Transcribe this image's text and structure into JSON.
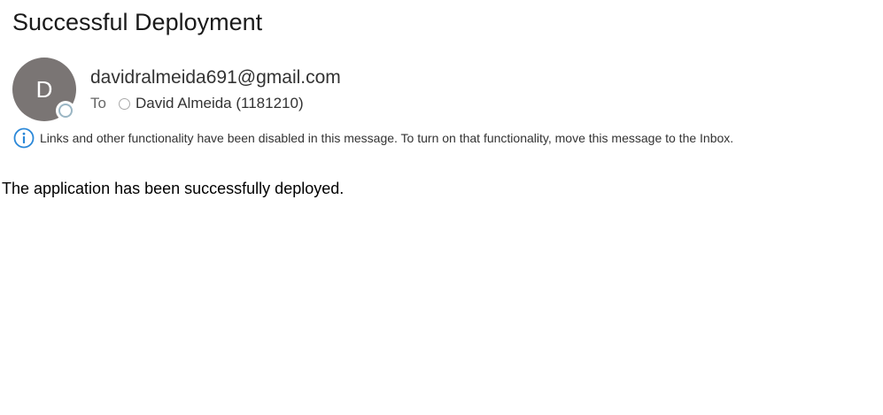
{
  "message": {
    "subject": "Successful Deployment",
    "avatar_initial": "D",
    "sender_email": "davidralmeida691@gmail.com",
    "to_label": "To",
    "recipient": "David Almeida (1181210)",
    "info_bar_text": "Links and other functionality have been disabled in this message. To turn on that functionality, move this message to the Inbox.",
    "body": "The application has been successfully deployed."
  },
  "icons": {
    "info": "info-icon",
    "presence": "presence-status-icon",
    "recipient_status": "recipient-status-icon"
  },
  "colors": {
    "avatar_bg": "#7a7574",
    "info_icon": "#2b88d8",
    "presence_ring": "#9bb6c4"
  }
}
